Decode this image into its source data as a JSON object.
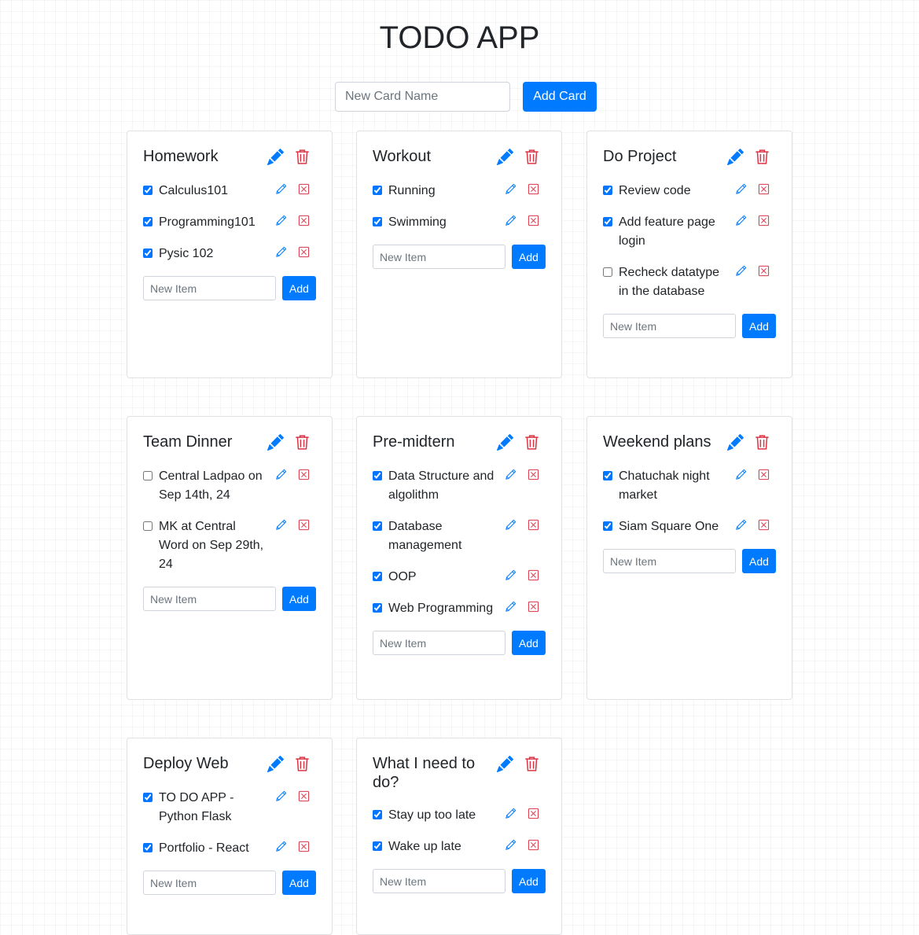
{
  "app": {
    "title": "TODO APP",
    "new_card_placeholder": "New Card Name",
    "add_card_label": "Add Card",
    "new_item_placeholder": "New Item",
    "add_item_label": "Add"
  },
  "colors": {
    "primary": "#007bff",
    "danger": "#dc3545",
    "text": "#212529",
    "border": "#dfe1e4"
  },
  "cards": [
    {
      "title": "Homework",
      "items": [
        {
          "text": "Calculus101",
          "checked": true
        },
        {
          "text": "Programming101",
          "checked": true
        },
        {
          "text": "Pysic 102",
          "checked": true
        }
      ]
    },
    {
      "title": "Workout",
      "items": [
        {
          "text": "Running",
          "checked": true
        },
        {
          "text": "Swimming",
          "checked": true
        }
      ]
    },
    {
      "title": "Do Project",
      "items": [
        {
          "text": "Review code",
          "checked": true
        },
        {
          "text": "Add feature page login",
          "checked": true
        },
        {
          "text": "Recheck datatype in the database",
          "checked": false
        }
      ]
    },
    {
      "title": "Team Dinner",
      "items": [
        {
          "text": "Central Ladpao on Sep 14th, 24",
          "checked": false
        },
        {
          "text": "MK at Central Word on Sep 29th, 24",
          "checked": false
        }
      ]
    },
    {
      "title": "Pre-midtern",
      "items": [
        {
          "text": "Data Structure and algolithm",
          "checked": true
        },
        {
          "text": "Database management",
          "checked": true
        },
        {
          "text": "OOP",
          "checked": true
        },
        {
          "text": "Web Programming",
          "checked": true
        }
      ]
    },
    {
      "title": "Weekend plans",
      "items": [
        {
          "text": "Chatuchak night market",
          "checked": true
        },
        {
          "text": "Siam Square One",
          "checked": true
        }
      ]
    },
    {
      "title": "Deploy Web",
      "items": [
        {
          "text": "TO DO APP - Python Flask",
          "checked": true
        },
        {
          "text": "Portfolio - React",
          "checked": true
        }
      ]
    },
    {
      "title": "What I need to do?",
      "items": [
        {
          "text": "Stay up too late",
          "checked": true
        },
        {
          "text": "Wake up late",
          "checked": true
        }
      ]
    }
  ]
}
